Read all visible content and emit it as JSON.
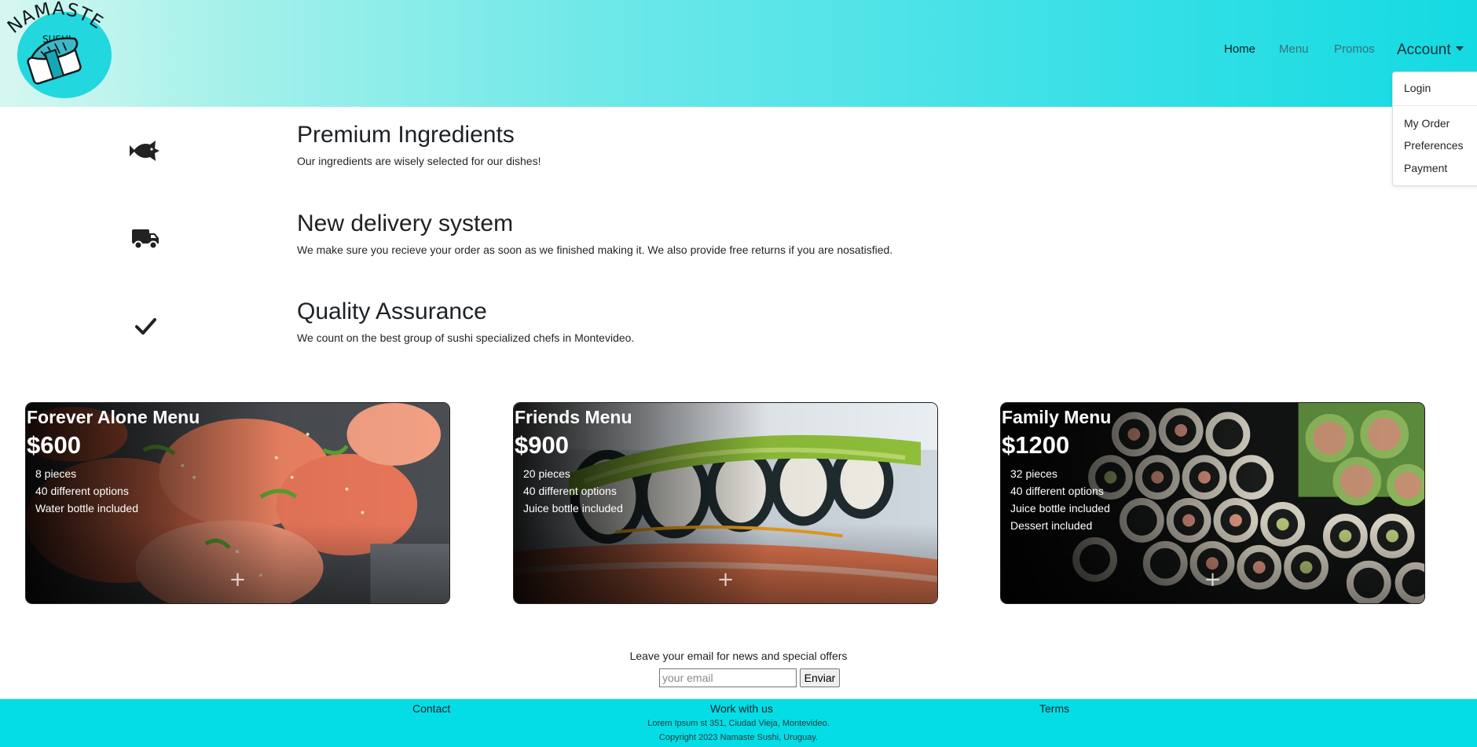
{
  "brand": {
    "logo_word": "NAMASTE",
    "logo_sub": "SUSHI"
  },
  "nav": {
    "home": "Home",
    "menu": "Menu",
    "promos": "Promos",
    "account": "Account"
  },
  "account_dropdown": {
    "items": [
      "Login",
      "My Order",
      "Preferences",
      "Payment"
    ]
  },
  "features": [
    {
      "icon": "fish-icon",
      "title": "Premium Ingredients",
      "text": "Our ingredients are wisely selected for our dishes!"
    },
    {
      "icon": "truck-icon",
      "title": "New delivery system",
      "text": "We make sure you recieve your order as soon as we finished making it. We also provide free returns if you are nosatisfied."
    },
    {
      "icon": "checkmark-icon",
      "title": "Quality Assurance",
      "text": "We count on the best group of sushi specialized chefs in Montevideo."
    }
  ],
  "cards": [
    {
      "title": "Forever Alone Menu",
      "price": "$600",
      "items": [
        "8 pieces",
        "40 different options",
        "Water bottle included"
      ],
      "add": "+"
    },
    {
      "title": "Friends Menu",
      "price": "$900",
      "items": [
        "20 pieces",
        "40 different options",
        "Juice bottle included"
      ],
      "add": "+"
    },
    {
      "title": "Family Menu",
      "price": "$1200",
      "items": [
        "32 pieces",
        "40 different options",
        "Juice bottle included",
        "Dessert included"
      ],
      "add": "+"
    }
  ],
  "newsletter": {
    "label": "Leave your email for news and special offers",
    "placeholder": "your email",
    "button": "Enviar"
  },
  "footer": {
    "contact": "Contact",
    "work": "Work with us",
    "terms": "Terms",
    "address": "Lorem Ipsum st 351, Ciudad Vieja, Montevideo.",
    "copyright": "Copyright 2023 Namaste Sushi, Uruguay."
  },
  "colors": {
    "header_gradient_start": "#d6f7f1",
    "header_gradient_end": "#14dae2",
    "footer": "#05dde6"
  }
}
